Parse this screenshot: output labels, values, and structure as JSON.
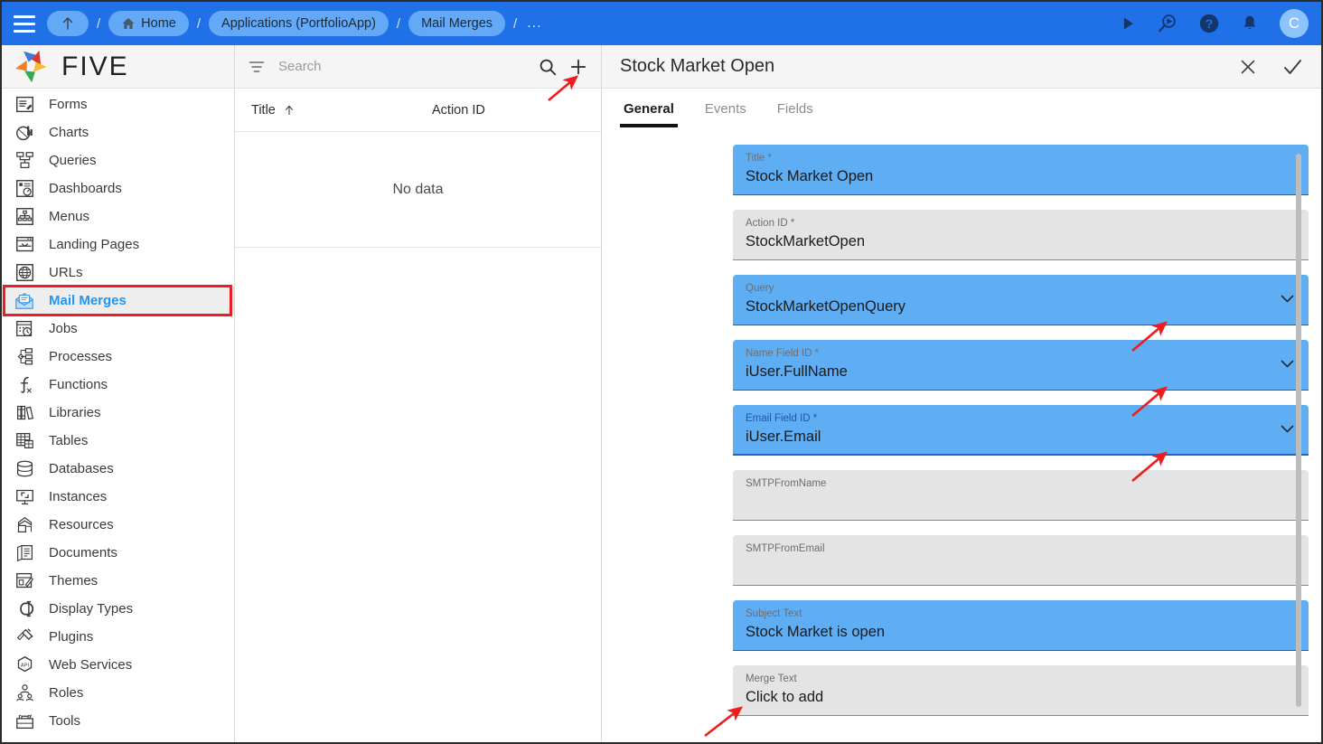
{
  "topbar": {
    "menu_icon": "hamburger-icon",
    "up_icon": "up-arrow-icon",
    "breadcrumbs": [
      {
        "label": "Home",
        "icon": "home-icon"
      },
      {
        "label": "Applications (PortfolioApp)",
        "icon": ""
      },
      {
        "label": "Mail Merges",
        "icon": ""
      }
    ],
    "separator": "/",
    "overflow": "...",
    "actions": [
      {
        "name": "run-icon",
        "title": "Run"
      },
      {
        "name": "debug-run-icon",
        "title": "Preview"
      },
      {
        "name": "help-icon",
        "title": "Help"
      },
      {
        "name": "notifications-bell-icon",
        "title": "Notifications"
      }
    ],
    "avatar_initial": "C",
    "bg_color": "#2070e8",
    "pill_color": "#63a9f7"
  },
  "sidebar": {
    "logo_text": "FIVE",
    "items": [
      {
        "label": "Forms",
        "icon": "forms-icon",
        "active": false
      },
      {
        "label": "Charts",
        "icon": "charts-icon",
        "active": false
      },
      {
        "label": "Queries",
        "icon": "queries-icon",
        "active": false
      },
      {
        "label": "Dashboards",
        "icon": "dashboards-icon",
        "active": false
      },
      {
        "label": "Menus",
        "icon": "menus-icon",
        "active": false
      },
      {
        "label": "Landing Pages",
        "icon": "landing-pages-icon",
        "active": false
      },
      {
        "label": "URLs",
        "icon": "urls-icon",
        "active": false
      },
      {
        "label": "Mail Merges",
        "icon": "mail-merges-icon",
        "active": true
      },
      {
        "label": "Jobs",
        "icon": "jobs-icon",
        "active": false
      },
      {
        "label": "Processes",
        "icon": "processes-icon",
        "active": false
      },
      {
        "label": "Functions",
        "icon": "functions-icon",
        "active": false
      },
      {
        "label": "Libraries",
        "icon": "libraries-icon",
        "active": false
      },
      {
        "label": "Tables",
        "icon": "tables-icon",
        "active": false
      },
      {
        "label": "Databases",
        "icon": "databases-icon",
        "active": false
      },
      {
        "label": "Instances",
        "icon": "instances-icon",
        "active": false
      },
      {
        "label": "Resources",
        "icon": "resources-icon",
        "active": false
      },
      {
        "label": "Documents",
        "icon": "documents-icon",
        "active": false
      },
      {
        "label": "Themes",
        "icon": "themes-icon",
        "active": false
      },
      {
        "label": "Display Types",
        "icon": "display-types-icon",
        "active": false
      },
      {
        "label": "Plugins",
        "icon": "plugins-icon",
        "active": false
      },
      {
        "label": "Web Services",
        "icon": "web-services-icon",
        "active": false
      },
      {
        "label": "Roles",
        "icon": "roles-icon",
        "active": false
      },
      {
        "label": "Tools",
        "icon": "tools-icon",
        "active": false
      }
    ],
    "highlight_color": "#ee1c25",
    "active_text_color": "#2196f3"
  },
  "list_panel": {
    "search_placeholder": "Search",
    "search_value": "",
    "filter_icon": "filter-icon",
    "search_icon": "search-icon",
    "add_icon": "plus-icon",
    "columns": [
      {
        "label": "Title",
        "sort": "ascending"
      },
      {
        "label": "Action ID",
        "sort": ""
      }
    ],
    "empty_text": "No data"
  },
  "detail": {
    "title": "Stock Market Open",
    "close_icon": "close-icon",
    "confirm_icon": "checkmark-icon",
    "tabs": [
      {
        "label": "General",
        "active": true
      },
      {
        "label": "Events",
        "active": false
      },
      {
        "label": "Fields",
        "active": false
      }
    ],
    "fields": [
      {
        "label": "Title *",
        "value": "Stock Market Open",
        "state": "selected",
        "dropdown": false,
        "help": "help-icon"
      },
      {
        "label": "Action ID *",
        "value": "StockMarketOpen",
        "state": "normal",
        "dropdown": false,
        "help": "help-icon"
      },
      {
        "label": "Query",
        "value": "StockMarketOpenQuery",
        "state": "selected",
        "dropdown": true,
        "help": "help-icon"
      },
      {
        "label": "Name Field ID *",
        "value": "iUser.FullName",
        "state": "selected",
        "dropdown": true,
        "help": "help-icon"
      },
      {
        "label": "Email Field ID *",
        "value": "iUser.Email",
        "state": "focused",
        "dropdown": true,
        "help": "help-icon"
      },
      {
        "label": "SMTPFromName",
        "value": "",
        "state": "normal",
        "dropdown": false,
        "help": "help-icon"
      },
      {
        "label": "SMTPFromEmail",
        "value": "",
        "state": "normal",
        "dropdown": false,
        "help": "help-icon"
      },
      {
        "label": "Subject Text",
        "value": "Stock Market is open",
        "state": "selected",
        "dropdown": false,
        "help": "help-icon"
      },
      {
        "label": "Merge Text",
        "value": "Click to add",
        "state": "normal",
        "dropdown": false,
        "help": "help-icon"
      }
    ],
    "field_selected_color": "#5faef4",
    "field_normal_color": "#e4e4e4"
  },
  "annotations": {
    "arrow_color": "#ee1c1c",
    "arrows": [
      {
        "name": "arrow-to-add-button",
        "target": "plus-icon"
      },
      {
        "name": "arrow-to-query-dropdown",
        "target": "query-field-chevron"
      },
      {
        "name": "arrow-to-name-field-dropdown",
        "target": "name-field-chevron"
      },
      {
        "name": "arrow-to-email-field-dropdown",
        "target": "email-field-chevron"
      },
      {
        "name": "arrow-to-merge-text",
        "target": "merge-text-field"
      }
    ]
  }
}
